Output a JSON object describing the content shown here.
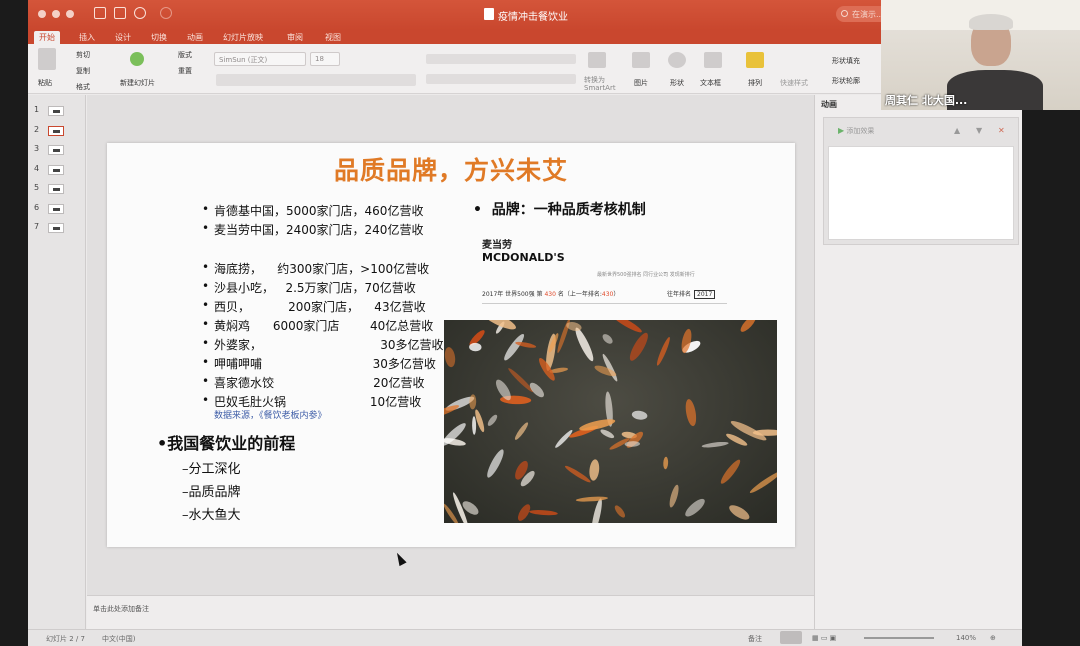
{
  "window": {
    "title": "疫情冲击餐饮业",
    "search_placeholder": "在演示..."
  },
  "menu_tabs": [
    "开始",
    "插入",
    "设计",
    "切换",
    "动画",
    "幻灯片放映",
    "审阅",
    "视图"
  ],
  "ribbon": {
    "paste": "粘贴",
    "cut": "剪切",
    "copy": "复制",
    "format": "格式",
    "new_slide": "新建幻灯片",
    "layout": "版式",
    "reset": "重置",
    "font_name": "SimSun (正文)",
    "font_size": "18",
    "convert_smartart": "转换为 SmartArt",
    "picture": "图片",
    "shape": "形状",
    "textbox": "文本框",
    "arrange": "排列",
    "quick_styles": "快速样式",
    "shape_fill": "形状填充",
    "shape_outline": "形状轮廓"
  },
  "thumbnails": [
    {
      "num": "1",
      "selected": false
    },
    {
      "num": "2",
      "selected": true
    },
    {
      "num": "3",
      "selected": false
    },
    {
      "num": "4",
      "selected": false
    },
    {
      "num": "5",
      "selected": false
    },
    {
      "num": "6",
      "selected": false
    },
    {
      "num": "7",
      "selected": false
    }
  ],
  "slide": {
    "title": "品质品牌，方兴未艾",
    "left_bullets": [
      "肯德基中国，5000家门店，460亿营收",
      "麦当劳中国，2400家门店，240亿营收",
      "海底捞，    约300家门店，>100亿营收",
      "沙县小吃，   2.5万家门店，70亿营收",
      "西贝，          200家门店，    43亿营收",
      "黄焖鸡      6000家门店        40亿总营收",
      "外婆家，                               30多亿营收",
      "呷哺呷哺                             30多亿营收",
      "喜家德水饺                          20亿营收",
      "巴奴毛肚火锅                      10亿营收"
    ],
    "source": "数据来源，《餐饮老板内参》",
    "future_heading": "•我国餐饮业的前程",
    "future_items": [
      "–分工深化",
      "–品质品牌",
      "–水大鱼大"
    ],
    "brand_heading": "品牌：一种品质考核机制",
    "mcd_cn": "麦当劳",
    "mcd_en": "MCDONALD'S",
    "mcd_small": "最新世界500强排名        同行业公司      发现新排行",
    "mcd_year_text": "2017年 世界500强 第",
    "mcd_rank": "430",
    "mcd_rank_suffix": "名（上一年排名:",
    "mcd_prev_rank": "430",
    "mcd_prev_suffix": "）",
    "mcd_history": "往年排名",
    "mcd_history_year": "2017"
  },
  "notes_placeholder": "单击此处添加备注",
  "pane": {
    "title": "动画",
    "add": "添加效果"
  },
  "status": {
    "slide_count": "幻灯片 2 / 7",
    "language": "中文(中国)",
    "notes": "备注",
    "comments": "批注",
    "zoom": "140%"
  },
  "webcam": {
    "name": "周其仁 北大国..."
  },
  "colors": {
    "accent": "#c9472e",
    "title_orange": "#e07a26",
    "source_blue": "#3f5ea8"
  }
}
